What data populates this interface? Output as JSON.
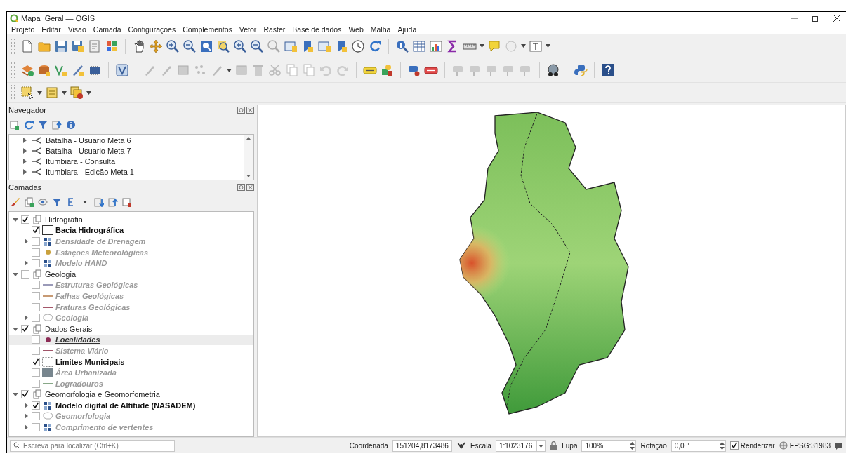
{
  "window": {
    "title": "Mapa_Geral — QGIS"
  },
  "menu": [
    {
      "label": "Projeto"
    },
    {
      "label": "Editar"
    },
    {
      "label": "Visão"
    },
    {
      "label": "Camada"
    },
    {
      "label": "Configurações"
    },
    {
      "label": "Complementos"
    },
    {
      "label": "Vetor"
    },
    {
      "label": "Raster"
    },
    {
      "label": "Base de dados"
    },
    {
      "label": "Web"
    },
    {
      "label": "Malha"
    },
    {
      "label": "Ajuda"
    }
  ],
  "navigator": {
    "title": "Navegador",
    "items": [
      {
        "label": "Batalha - Usuario Meta 6",
        "expanded": false
      },
      {
        "label": "Batalha - Usuario Meta 7",
        "expanded": false
      },
      {
        "label": "Itumbiara - Consulta",
        "expanded": false
      },
      {
        "label": "Itumbiara - Edicão Meta 1",
        "expanded": false
      }
    ]
  },
  "layers": {
    "title": "Camadas",
    "tree": [
      {
        "label": "Hidrografia",
        "kind": "group",
        "checked": true,
        "expanded": true,
        "selected": false,
        "children": [
          {
            "label": "Bacia Hidrográfica",
            "kind": "polygon-outline",
            "checked": true,
            "selected": false
          },
          {
            "label": "Densidade de Drenagem",
            "kind": "raster",
            "checked": false,
            "expanded": false,
            "selected": false
          },
          {
            "label": "Estações Meteorológicas",
            "kind": "point",
            "color": "#c9a13c",
            "checked": false,
            "selected": false
          },
          {
            "label": "Modelo HAND",
            "kind": "raster",
            "checked": false,
            "expanded": false,
            "selected": false
          }
        ]
      },
      {
        "label": "Geologia",
        "kind": "group",
        "checked": false,
        "expanded": true,
        "selected": false,
        "children": [
          {
            "label": "Estruturas Geológicas",
            "kind": "line",
            "color": "#9a9ab8",
            "checked": false,
            "selected": false
          },
          {
            "label": "Falhas Geológicas",
            "kind": "line",
            "color": "#c79a74",
            "checked": false,
            "selected": false
          },
          {
            "label": "Fraturas Geológicas",
            "kind": "line",
            "color": "#a4566a",
            "checked": false,
            "selected": false
          },
          {
            "label": "Geologia",
            "kind": "polygon-categorized",
            "checked": false,
            "expanded": false,
            "selected": false
          }
        ]
      },
      {
        "label": "Dados Gerais",
        "kind": "group",
        "checked": true,
        "expanded": true,
        "selected": false,
        "children": [
          {
            "label": "Localidades",
            "kind": "point",
            "color": "#8c2b55",
            "checked": false,
            "selected": true
          },
          {
            "label": "Sistema Viário",
            "kind": "line",
            "color": "#a05468",
            "checked": false,
            "selected": false
          },
          {
            "label": "Limites Municipais",
            "kind": "polygon-dashed",
            "checked": true,
            "selected": false
          },
          {
            "label": "Área Urbanizada",
            "kind": "polygon-fill",
            "color": "#78868e",
            "checked": false,
            "selected": false
          },
          {
            "label": "Logradouros",
            "kind": "line",
            "color": "#88a888",
            "checked": false,
            "selected": false
          }
        ]
      },
      {
        "label": "Geomorfologia e Geomorfometria",
        "kind": "group",
        "checked": true,
        "expanded": true,
        "selected": false,
        "children": [
          {
            "label": "Modelo digital de Altitude (NASADEM)",
            "kind": "raster",
            "checked": true,
            "expanded": false,
            "selected": false
          },
          {
            "label": "Geomorfologia",
            "kind": "polygon-categorized",
            "checked": false,
            "expanded": false,
            "selected": false
          },
          {
            "label": "Comprimento de vertentes",
            "kind": "raster",
            "checked": false,
            "expanded": false,
            "selected": false
          }
        ]
      }
    ]
  },
  "status_bar": {
    "search": {
      "placeholder": "Escreva para localizar (Ctrl+K)"
    },
    "coordinate": {
      "label": "Coordenada",
      "value": "151204,8173486"
    },
    "scale": {
      "label": "Escala",
      "value": "1:1023176"
    },
    "magnifier": {
      "label": "Lupa",
      "value": "100%"
    },
    "rotation": {
      "label": "Rotação",
      "value": "0,0 °"
    },
    "render": {
      "label": "Renderizar",
      "checked": true
    },
    "crs": {
      "label": "EPSG:31983"
    }
  }
}
